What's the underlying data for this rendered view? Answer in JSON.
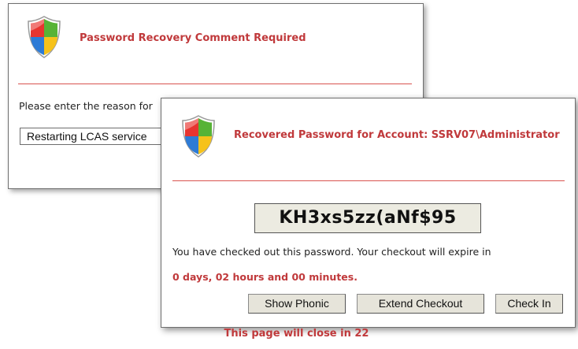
{
  "recovery_dialog": {
    "title": "Password Recovery Comment Required",
    "prompt": "Please enter the reason for",
    "reason_value": "Restarting LCAS service"
  },
  "password_dialog": {
    "title": "Recovered Password for Account: SSRV07\\Administrator",
    "password": "KH3xs5zz(aNf$95",
    "checkout_message": "You have checked out this password. Your checkout will expire in",
    "expiry": "0 days, 02 hours and 00 minutes.",
    "buttons": {
      "show_phonic": "Show Phonic",
      "extend_checkout": "Extend Checkout",
      "check_in": "Check In"
    },
    "close_notice": "This page will close in 22"
  },
  "icons": {
    "shield": "windows-security-shield-icon"
  },
  "colors": {
    "accent_red": "#c0393b",
    "password_bg": "#ecebe1",
    "button_bg": "#e6e4da"
  }
}
